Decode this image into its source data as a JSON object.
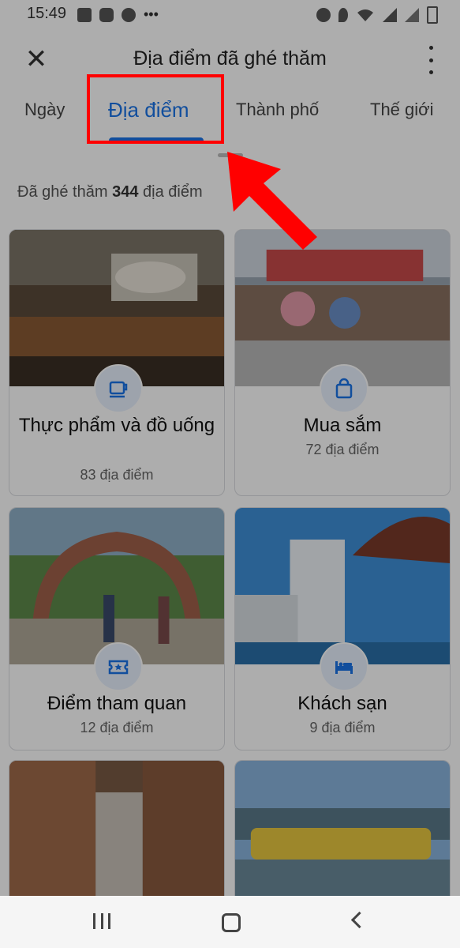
{
  "status_bar": {
    "time": "15:49",
    "left_icons": [
      "gallery-icon",
      "instagram-icon",
      "app-icon",
      "more-dots"
    ],
    "right_icons": [
      "alarm-icon",
      "location-icon",
      "wifi-icon",
      "signal-icon",
      "signal-icon-2",
      "battery-icon"
    ]
  },
  "appbar": {
    "title": "Địa điểm đã ghé thăm",
    "close_icon": "close-icon",
    "more_icon": "more-vert-icon"
  },
  "tabs": [
    {
      "label": "Ngày",
      "active": false
    },
    {
      "label": "Địa điểm",
      "active": true
    },
    {
      "label": "Thành phố",
      "active": false
    },
    {
      "label": "Thế giới",
      "active": false
    }
  ],
  "summary": {
    "prefix": "Đã ghé thăm ",
    "count": "344",
    "suffix": " địa điểm"
  },
  "cards": [
    {
      "name": "Thực phẩm và đồ uống",
      "sub": "83 địa điểm",
      "icon": "coffee-cup-icon"
    },
    {
      "name": "Mua sắm",
      "sub": "72 địa điểm",
      "icon": "shopping-bag-icon"
    },
    {
      "name": "Điểm tham quan",
      "sub": "12 địa điểm",
      "icon": "ticket-icon"
    },
    {
      "name": "Khách sạn",
      "sub": "9 địa điểm",
      "icon": "bed-icon"
    }
  ],
  "colors": {
    "accent": "#1a73e8",
    "highlight": "#ff0000",
    "icon_bg": "#e8f0fe"
  }
}
